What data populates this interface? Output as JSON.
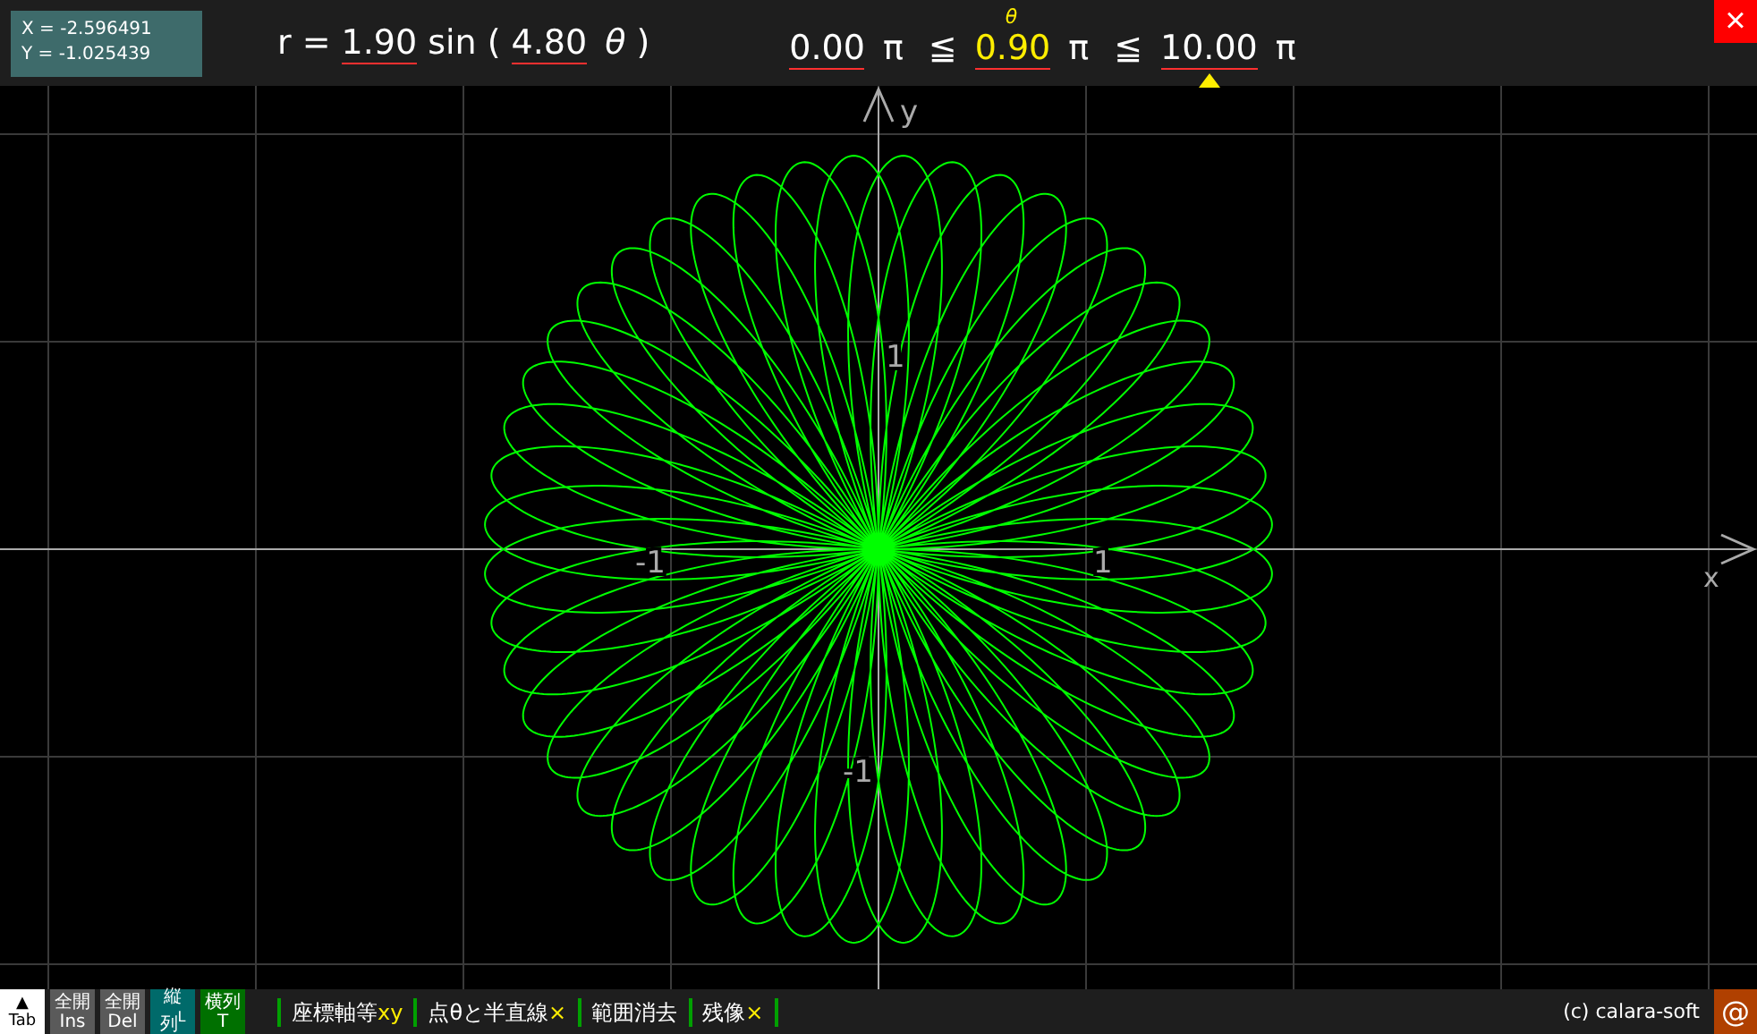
{
  "cursor": {
    "x": "X = -2.596491",
    "y": "Y = -1.025439"
  },
  "formula": {
    "lhs": "r =",
    "amplitude": "1.90",
    "func": "sin (",
    "frequency": "4.80",
    "variable": "θ",
    "close": ")"
  },
  "range": [
    {
      "kind": "bound",
      "text": "0.00",
      "selected": false
    },
    {
      "kind": "symbol",
      "text": "π"
    },
    {
      "kind": "symbol",
      "text": "≦"
    },
    {
      "kind": "current",
      "text": "0.90",
      "label": "θ"
    },
    {
      "kind": "symbol",
      "text": "π"
    },
    {
      "kind": "symbol",
      "text": "≦"
    },
    {
      "kind": "bound",
      "text": "10.00",
      "selected": true
    },
    {
      "kind": "symbol",
      "text": "π"
    }
  ],
  "close_button": "×",
  "graph": {
    "x_axis_label": "x",
    "y_axis_label": "y",
    "ticks": [
      {
        "kind": "y_pos",
        "text": "1"
      },
      {
        "kind": "x_neg",
        "text": "-1"
      },
      {
        "kind": "x_pos",
        "text": "1"
      },
      {
        "kind": "y_neg",
        "text": "-1"
      }
    ]
  },
  "toolbar": {
    "tab_button": {
      "icon": "▲",
      "label": "Tab"
    },
    "buttons": [
      {
        "top": "全開",
        "bottom": "Ins",
        "kind": "grey"
      },
      {
        "top": "全開",
        "bottom": "Del",
        "kind": "grey"
      },
      {
        "top": "縦",
        "bottom": "列",
        "side": "L",
        "kind": "teal"
      },
      {
        "top": "横列",
        "bottom": "T",
        "kind": "green"
      }
    ],
    "toggles": [
      {
        "label": "座標軸等",
        "mark": "xy"
      },
      {
        "label": "点θと半直線",
        "mark": "×"
      },
      {
        "label": "範囲消去"
      },
      {
        "label": "残像",
        "mark": "×"
      }
    ],
    "copyright": "(c) calara-soft",
    "at_button": "@"
  }
}
